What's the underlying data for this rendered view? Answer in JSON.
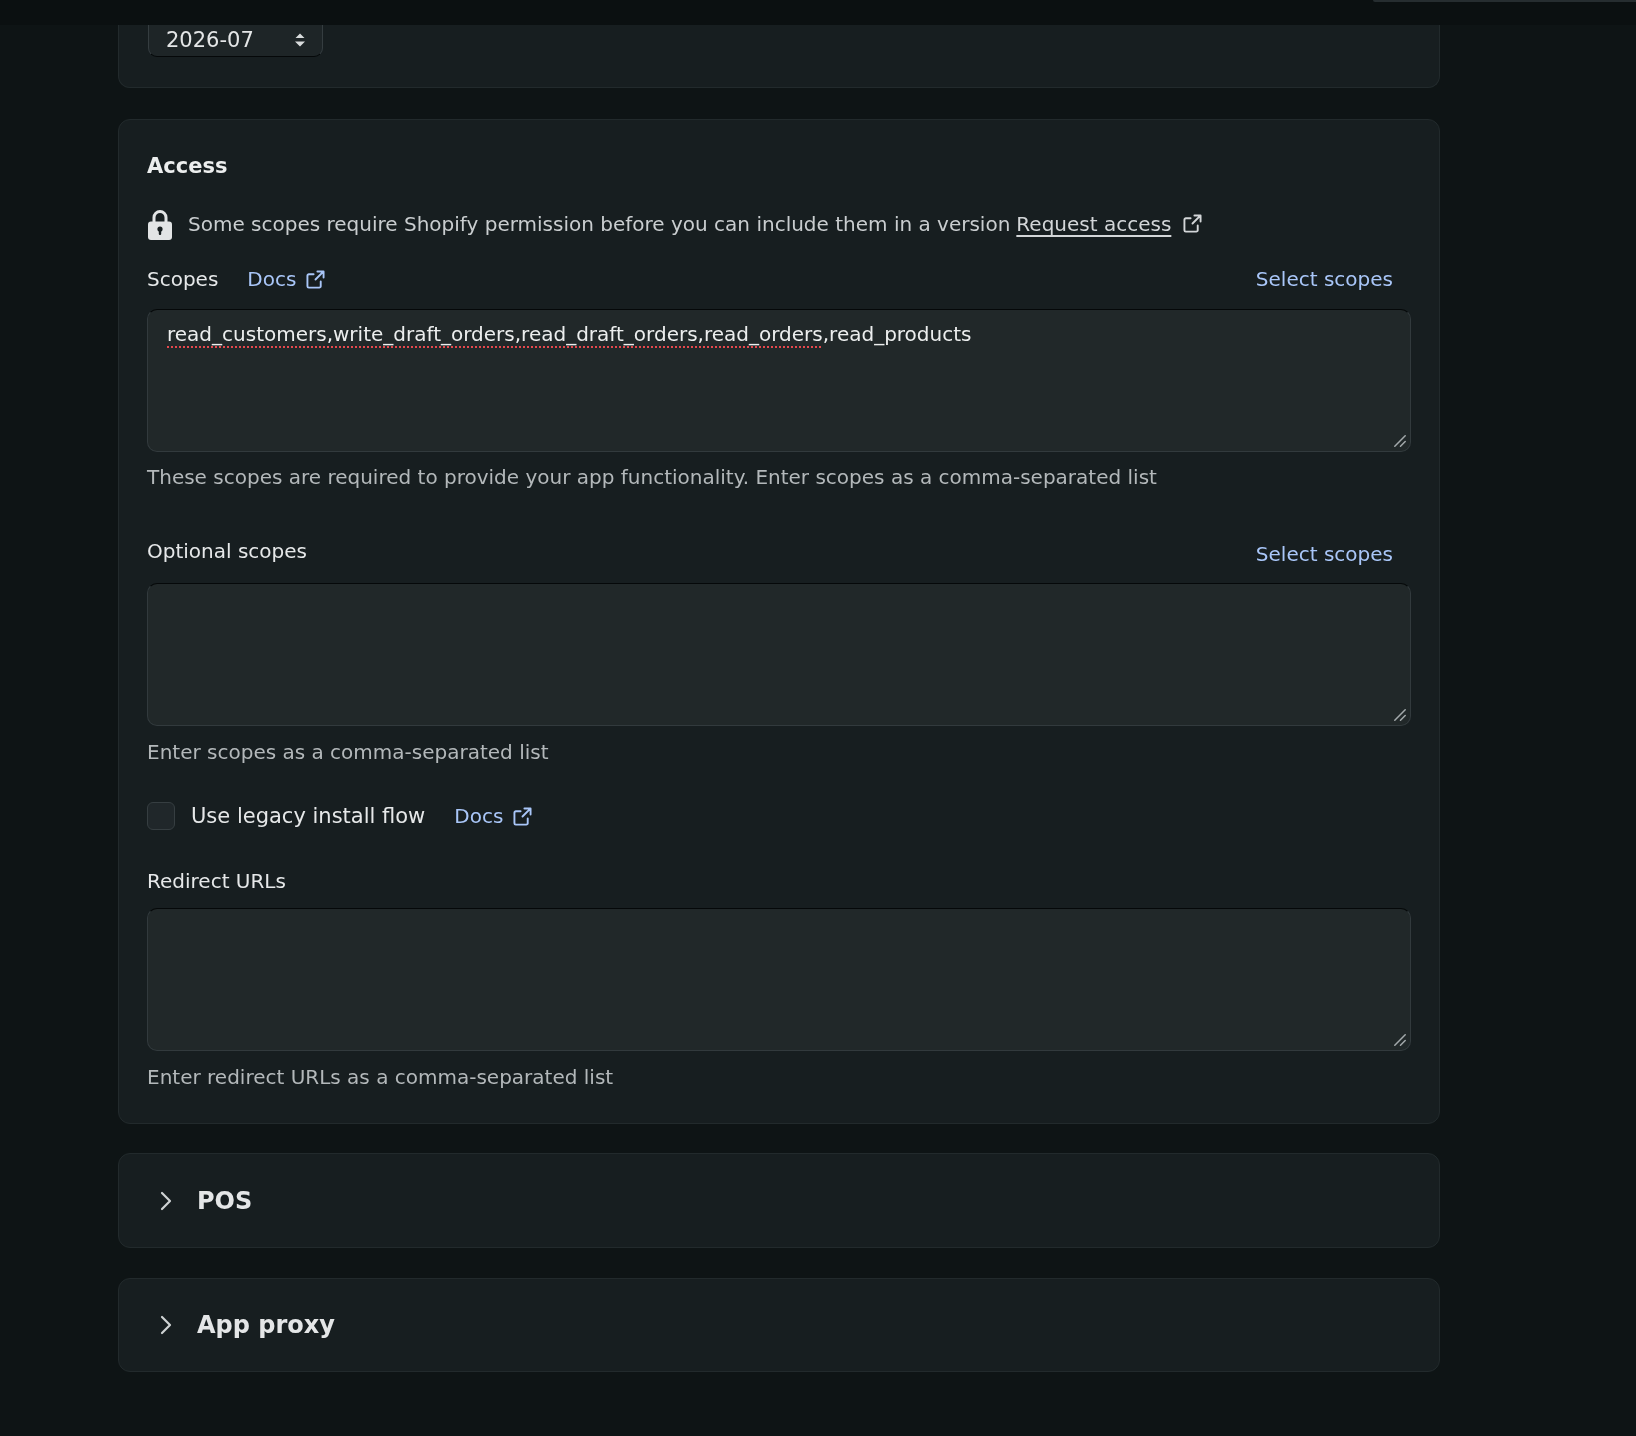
{
  "version": {
    "select": {
      "value": "2026-07"
    }
  },
  "access": {
    "title": "Access",
    "notice": {
      "text": "Some scopes require Shopify permission before you can include them in a version",
      "link": "Request access"
    },
    "scopes": {
      "label": "Scopes",
      "docs_link": "Docs",
      "action": "Select scopes",
      "value_segments": [
        {
          "text": "read_customers,write_draft_orders,read_draft_orders,read_orders",
          "misspelled": true
        },
        {
          "text": ",read_products",
          "misspelled": false
        }
      ],
      "help": "These scopes are required to provide your app functionality. Enter scopes as a comma-separated list"
    },
    "optional_scopes": {
      "label": "Optional scopes",
      "action": "Select scopes",
      "help": "Enter scopes as a comma-separated list"
    },
    "legacy_install_flow": {
      "label": "Use legacy install flow",
      "checked": false,
      "docs_link": "Docs"
    },
    "redirect_urls": {
      "label": "Redirect URLs",
      "help": "Enter redirect URLs as a comma-separated list"
    }
  },
  "sections": [
    {
      "title": "POS",
      "expanded": false
    },
    {
      "title": "App proxy",
      "expanded": false
    }
  ]
}
